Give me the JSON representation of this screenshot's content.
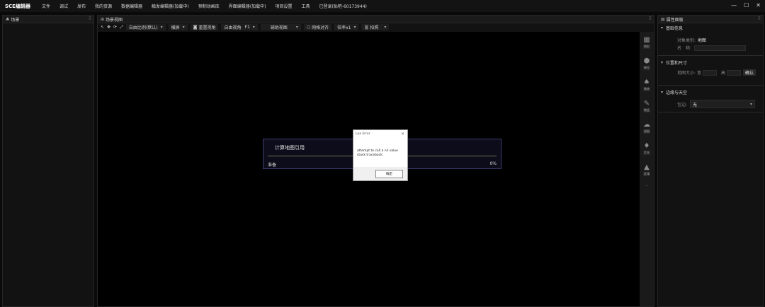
{
  "app": {
    "title": "SCE编辑器",
    "menus": [
      "文件",
      "调试",
      "发布",
      "我的资源",
      "数据编辑器",
      "触发编辑器(加载中)",
      "预制动画库",
      "界面编辑器(加载中)",
      "项目设置",
      "工具",
      "已登录(贴吧-60173944)"
    ],
    "window_controls": [
      "—",
      "☐",
      "✕"
    ]
  },
  "scene_panel": {
    "title": "场景",
    "icon": "tree-icon"
  },
  "view_panel": {
    "title": "场景视图",
    "toolbar": {
      "tools": [
        "↖",
        "✥",
        "⟳",
        "⤢"
      ],
      "ratio": "自由比例(默认)",
      "orientation": "横屏",
      "reset": "重置视角",
      "view": "自由视角",
      "view_key": "F1",
      "aux": "辅助视图",
      "grid": "网格对齐",
      "speed": "倍率x1",
      "capture": "拍照"
    },
    "side_tools": [
      {
        "label": "地形",
        "icon": "terrain-icon"
      },
      {
        "label": "单位",
        "icon": "unit-icon"
      },
      {
        "label": "装饰",
        "icon": "tree-icon"
      },
      {
        "label": "物品",
        "icon": "item-icon"
      },
      {
        "label": "视图",
        "icon": "cloud-icon"
      },
      {
        "label": "灯光",
        "icon": "light-icon"
      },
      {
        "label": "区域",
        "icon": "region-icon"
      }
    ]
  },
  "progress": {
    "title": "计算地图引用",
    "status": "准备",
    "percent_text": "0%",
    "percent": 0
  },
  "dialog": {
    "title": "Lua Error",
    "close": "✕",
    "line1": "attempt to call a nil value",
    "line2": "stack traceback:",
    "ok": "确定"
  },
  "properties": {
    "title": "属性面板",
    "basic": {
      "header": "基础信息",
      "type_label": "对象类别:",
      "type_value": "地图",
      "name_label": "名　称:",
      "name_value": ""
    },
    "size": {
      "header": "位置和尺寸",
      "map_size_label": "地图大小:",
      "width_label": "宽",
      "width_value": "",
      "height_label": "高",
      "height_value": "",
      "confirm": "确认"
    },
    "edge": {
      "header": "边缘与天空",
      "edge_label": "包边:",
      "edge_value": "无"
    }
  },
  "colors": {
    "accent": "#6a6aff",
    "panel": "#121212",
    "progress_border": "#3b3b6e"
  }
}
